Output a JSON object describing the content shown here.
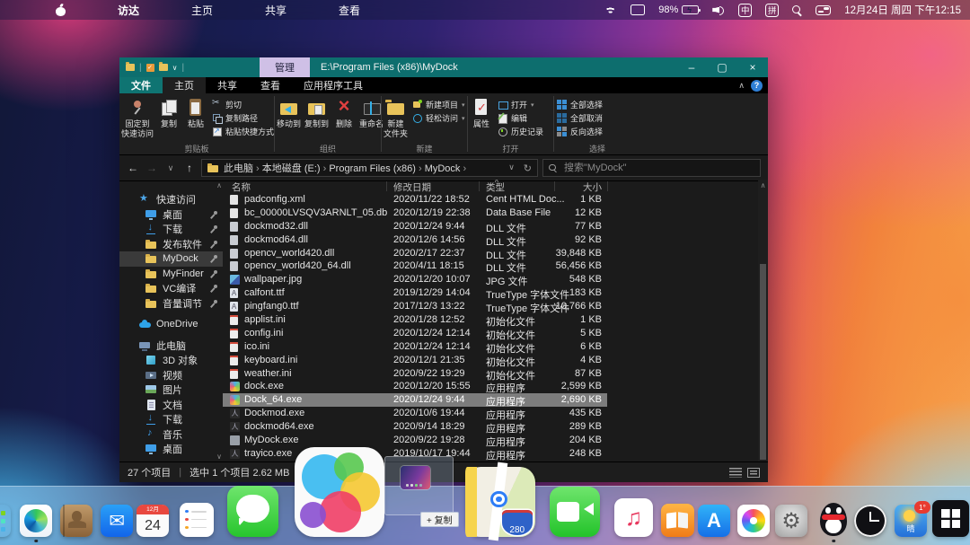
{
  "menubar": {
    "menus": [
      "访达",
      "主页",
      "共享",
      "查看"
    ],
    "battery_percent": "98%",
    "ime_badge": "中",
    "pinyin_badge": "拼",
    "datetime": "12月24日 周四 下午12:15"
  },
  "explorer": {
    "context_tab": "管理",
    "title": "E:\\Program Files (x86)\\MyDock",
    "tabs": [
      "文件",
      "主页",
      "共享",
      "查看",
      "应用程序工具"
    ],
    "active_tab": "主页",
    "ribbon": {
      "groups": [
        {
          "label": "剪贴板",
          "big": [
            {
              "icon": "pin",
              "lines": [
                "固定到",
                "快速访问"
              ]
            },
            {
              "icon": "copy",
              "lines": [
                "复制"
              ]
            },
            {
              "icon": "paste",
              "lines": [
                "粘贴"
              ]
            }
          ],
          "small": [
            {
              "icon": "cut",
              "label": "剪切"
            },
            {
              "icon": "path",
              "label": "复制路径"
            },
            {
              "icon": "shortcut",
              "label": "粘贴快捷方式"
            }
          ]
        },
        {
          "label": "组织",
          "big": [
            {
              "icon": "move",
              "lines": [
                "移动到"
              ]
            },
            {
              "icon": "copyto",
              "lines": [
                "复制到"
              ]
            },
            {
              "icon": "del",
              "lines": [
                "删除"
              ]
            },
            {
              "icon": "rename",
              "lines": [
                "重命名"
              ]
            }
          ],
          "small": []
        },
        {
          "label": "新建",
          "big": [
            {
              "icon": "newfolder",
              "lines": [
                "新建",
                "文件夹"
              ]
            }
          ],
          "small": [
            {
              "icon": "newitem",
              "label": "新建项目",
              "caret": true
            },
            {
              "icon": "easy",
              "label": "轻松访问",
              "caret": true
            }
          ]
        },
        {
          "label": "打开",
          "big": [
            {
              "icon": "props",
              "lines": [
                "属性"
              ]
            }
          ],
          "small": [
            {
              "icon": "open",
              "label": "打开",
              "caret": true
            },
            {
              "icon": "edit",
              "label": "编辑"
            },
            {
              "icon": "history",
              "label": "历史记录"
            }
          ]
        },
        {
          "label": "选择",
          "big": [],
          "small": [
            {
              "icon": "selall",
              "label": "全部选择"
            },
            {
              "icon": "selnone",
              "label": "全部取消"
            },
            {
              "icon": "selinv",
              "label": "反向选择"
            }
          ]
        }
      ]
    },
    "address": {
      "crumbs": [
        "此电脑",
        "本地磁盘 (E:)",
        "Program Files (x86)",
        "MyDock"
      ],
      "search_placeholder": "搜索\"MyDock\""
    },
    "sidebar": [
      {
        "label": "快速访问",
        "icon": "star",
        "level": 0
      },
      {
        "label": "桌面",
        "icon": "desktop",
        "level": 1,
        "pin": true
      },
      {
        "label": "下载",
        "icon": "download",
        "level": 1,
        "pin": true
      },
      {
        "label": "发布软件",
        "icon": "folder",
        "level": 1,
        "pin": true
      },
      {
        "label": "MyDock",
        "icon": "folder",
        "level": 1,
        "pin": true,
        "selected": true
      },
      {
        "label": "MyFinder",
        "icon": "folder",
        "level": 1,
        "pin": true
      },
      {
        "label": "VC编译",
        "icon": "folder",
        "level": 1,
        "pin": true
      },
      {
        "label": "音量调节",
        "icon": "folder",
        "level": 1,
        "pin": true
      },
      {
        "label": "OneDrive",
        "icon": "cloud",
        "level": 0,
        "gap": true
      },
      {
        "label": "此电脑",
        "icon": "pc",
        "level": 0,
        "gap": true
      },
      {
        "label": "3D 对象",
        "icon": "cube",
        "level": 1
      },
      {
        "label": "视频",
        "icon": "video",
        "level": 1
      },
      {
        "label": "图片",
        "icon": "image",
        "level": 1
      },
      {
        "label": "文档",
        "icon": "docs",
        "level": 1
      },
      {
        "label": "下载",
        "icon": "download",
        "level": 1
      },
      {
        "label": "音乐",
        "icon": "music",
        "level": 1
      },
      {
        "label": "桌面",
        "icon": "desktop",
        "level": 1
      }
    ],
    "files": {
      "columns": [
        "名称",
        "修改日期",
        "类型",
        "大小"
      ],
      "sorted_column": "类型",
      "rows": [
        {
          "name": "padconfig.xml",
          "date": "2020/11/22 18:52",
          "type": "Cent HTML Doc...",
          "size": "1 KB",
          "icon": "doc"
        },
        {
          "name": "bc_00000LVSQV3ARNLT_05.db",
          "date": "2020/12/19 22:38",
          "type": "Data Base File",
          "size": "12 KB",
          "icon": "doc"
        },
        {
          "name": "dockmod32.dll",
          "date": "2020/12/24 9:44",
          "type": "DLL 文件",
          "size": "77 KB",
          "icon": "dll"
        },
        {
          "name": "dockmod64.dll",
          "date": "2020/12/6 14:56",
          "type": "DLL 文件",
          "size": "92 KB",
          "icon": "dll"
        },
        {
          "name": "opencv_world420.dll",
          "date": "2020/2/17 22:37",
          "type": "DLL 文件",
          "size": "39,848 KB",
          "icon": "dll"
        },
        {
          "name": "opencv_world420_64.dll",
          "date": "2020/4/11 18:15",
          "type": "DLL 文件",
          "size": "56,456 KB",
          "icon": "dll"
        },
        {
          "name": "wallpaper.jpg",
          "date": "2020/12/20 10:07",
          "type": "JPG 文件",
          "size": "548 KB",
          "icon": "img"
        },
        {
          "name": "calfont.ttf",
          "date": "2019/12/29 14:04",
          "type": "TrueType 字体文件",
          "size": "183 KB",
          "icon": "font"
        },
        {
          "name": "pingfang0.ttf",
          "date": "2017/12/3 13:22",
          "type": "TrueType 字体文件",
          "size": "10,766 KB",
          "icon": "font"
        },
        {
          "name": "applist.ini",
          "date": "2020/1/28 12:52",
          "type": "初始化文件",
          "size": "1 KB",
          "icon": "ini"
        },
        {
          "name": "config.ini",
          "date": "2020/12/24 12:14",
          "type": "初始化文件",
          "size": "5 KB",
          "icon": "ini"
        },
        {
          "name": "ico.ini",
          "date": "2020/12/24 12:14",
          "type": "初始化文件",
          "size": "6 KB",
          "icon": "ini"
        },
        {
          "name": "keyboard.ini",
          "date": "2020/12/1 21:35",
          "type": "初始化文件",
          "size": "4 KB",
          "icon": "ini"
        },
        {
          "name": "weather.ini",
          "date": "2020/9/22 19:29",
          "type": "初始化文件",
          "size": "87 KB",
          "icon": "ini"
        },
        {
          "name": "dock.exe",
          "date": "2020/12/20 15:55",
          "type": "应用程序",
          "size": "2,599 KB",
          "icon": "exeC"
        },
        {
          "name": "Dock_64.exe",
          "date": "2020/12/24 9:44",
          "type": "应用程序",
          "size": "2,690 KB",
          "icon": "exeC",
          "selected": true
        },
        {
          "name": "Dockmod.exe",
          "date": "2020/10/6 19:44",
          "type": "应用程序",
          "size": "435 KB",
          "icon": "exeP"
        },
        {
          "name": "dockmod64.exe",
          "date": "2020/9/14 18:29",
          "type": "应用程序",
          "size": "289 KB",
          "icon": "exeP"
        },
        {
          "name": "MyDock.exe",
          "date": "2020/9/22 19:28",
          "type": "应用程序",
          "size": "204 KB",
          "icon": "exeG"
        },
        {
          "name": "trayico.exe",
          "date": "2019/10/17 19:44",
          "type": "应用程序",
          "size": "248 KB",
          "icon": "exeP"
        }
      ]
    },
    "statusbar": {
      "items": "27 个项目",
      "selection": "选中 1 个项目 2.62 MB"
    }
  },
  "dock": {
    "icons": [
      {
        "id": "launchpad",
        "name": "launchpad"
      },
      {
        "id": "edge",
        "name": "microsoft-edge",
        "running": true
      },
      {
        "id": "contacts",
        "name": "contacts"
      },
      {
        "id": "mail",
        "name": "mail"
      },
      {
        "id": "calendar",
        "name": "calendar",
        "month": "12月",
        "day": "24"
      },
      {
        "id": "reminders",
        "name": "reminders"
      },
      {
        "id": "messages",
        "name": "messages"
      },
      {
        "id": "gamecenter",
        "name": "game-center"
      },
      {
        "id": "maps",
        "name": "maps",
        "shield": "280"
      },
      {
        "id": "facetime",
        "name": "facetime"
      },
      {
        "id": "music",
        "name": "music"
      },
      {
        "id": "books",
        "name": "books"
      },
      {
        "id": "appstore",
        "name": "app-store"
      },
      {
        "id": "photos",
        "name": "photos"
      },
      {
        "id": "settings",
        "name": "system-preferences"
      },
      {
        "id": "qq",
        "name": "qq",
        "running": true
      },
      {
        "id": "clock",
        "name": "clock"
      },
      {
        "id": "weather",
        "name": "weather",
        "label": "晴",
        "badge": "1°"
      },
      {
        "id": "windows",
        "name": "windows-desktop"
      }
    ],
    "drag_copy_label": "+ 复制"
  },
  "colors": {
    "titlebar": "#0d6e6e",
    "context_tab_bg": "#cfc0e6",
    "accent_blue": "#3b8fd4",
    "selection_gray": "#7d7d7d",
    "dock_bg": "rgba(146,196,235,0.55)"
  }
}
